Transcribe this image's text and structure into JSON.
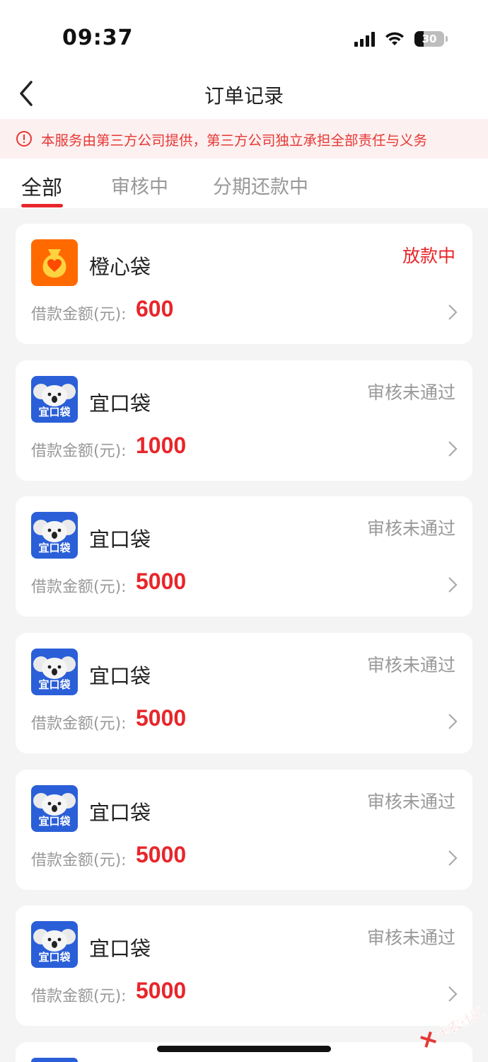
{
  "status_bar": {
    "time": "09:37",
    "battery": "30"
  },
  "header": {
    "title": "订单记录"
  },
  "notice": {
    "text": "本服务由第三方公司提供，第三方公司独立承担全部责任与义务"
  },
  "tabs": [
    {
      "label": "全部",
      "active": true
    },
    {
      "label": "审核中",
      "active": false
    },
    {
      "label": "分期还款中",
      "active": false
    }
  ],
  "orders": [
    {
      "name": "橙心袋",
      "status": "放款中",
      "amount_label": "借款金额(元):",
      "amount": "600",
      "logo": "orange-heart-bag"
    },
    {
      "name": "宜口袋",
      "status": "审核未通过",
      "amount_label": "借款金额(元):",
      "amount": "1000",
      "logo": "koala"
    },
    {
      "name": "宜口袋",
      "status": "审核未通过",
      "amount_label": "借款金额(元):",
      "amount": "5000",
      "logo": "koala"
    },
    {
      "name": "宜口袋",
      "status": "审核未通过",
      "amount_label": "借款金额(元):",
      "amount": "5000",
      "logo": "koala"
    },
    {
      "name": "宜口袋",
      "status": "审核未通过",
      "amount_label": "借款金额(元):",
      "amount": "5000",
      "logo": "koala"
    },
    {
      "name": "宜口袋",
      "status": "审核未通过",
      "amount_label": "借款金额(元):",
      "amount": "5000",
      "logo": "koala"
    }
  ],
  "logo_text": {
    "koala": "宜口袋"
  },
  "watermark": {
    "text": "卡农社区"
  },
  "colors": {
    "accent": "#e8262b",
    "notice_bg": "#fdf0f0",
    "muted": "#999999",
    "koala_blue": "#2a5fd8",
    "orange": "#ff6a00"
  }
}
